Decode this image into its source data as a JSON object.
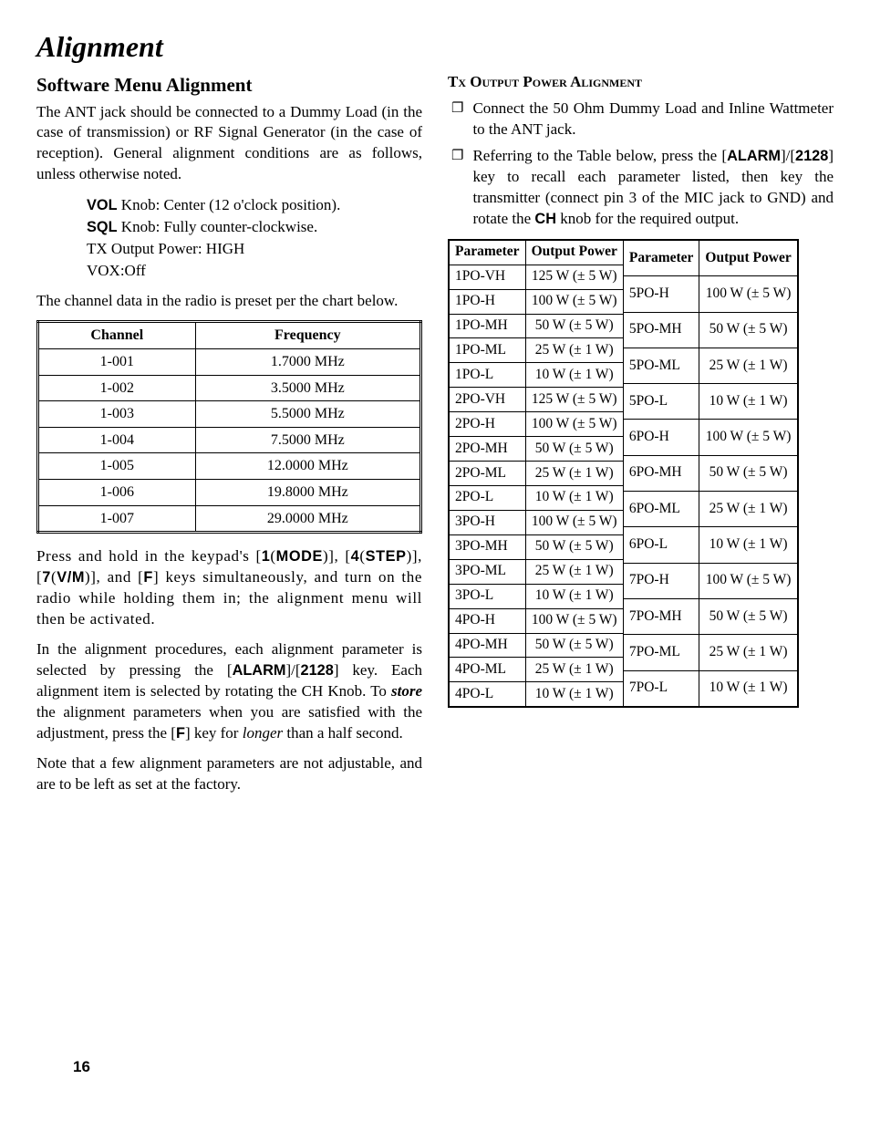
{
  "title": "Alignment",
  "page_number": "16",
  "left": {
    "subhead": "Software Menu Alignment",
    "p1_a": "The ANT jack should be connected to a Dummy Load (in the case of transmission) or RF Signal Generator (in the case of reception). General alignment conditions are as follows, unless otherwise noted.",
    "knob": {
      "l1a": "VOL",
      "l1b": " Knob: Center (12 o'clock position).",
      "l2a": "SQL",
      "l2b": " Knob: Fully counter-clockwise.",
      "l3": "TX Output Power: HIGH",
      "l4": "VOX:Off"
    },
    "p2": "The channel data in the radio is preset per the chart below.",
    "table_headers": {
      "c": "Channel",
      "f": "Frequency"
    },
    "channels": [
      {
        "c": "1-001",
        "f": "1.7000 MHz"
      },
      {
        "c": "1-002",
        "f": "3.5000 MHz"
      },
      {
        "c": "1-003",
        "f": "5.5000 MHz"
      },
      {
        "c": "1-004",
        "f": "7.5000 MHz"
      },
      {
        "c": "1-005",
        "f": "12.0000 MHz"
      },
      {
        "c": "1-006",
        "f": "19.8000 MHz"
      },
      {
        "c": "1-007",
        "f": "29.0000 MHz"
      }
    ],
    "p3_parts": {
      "a": "Press and hold in the keypad's [",
      "b": "1",
      "c": "(",
      "d": "MODE",
      "e": ")], [",
      "f": "4",
      "g": "(",
      "h": "STEP",
      "i": ")], [",
      "j": "7",
      "k": "(",
      "l": "V/M",
      "m": ")], and [",
      "n": "F",
      "o": "] keys simultaneously, and turn on the radio while holding them in; the alignment menu will then be activated."
    },
    "p4_parts": {
      "a": "In the alignment procedures, each alignment parameter is selected by pressing the [",
      "b": "ALARM",
      "c": "]/[",
      "d": "2128",
      "e": "] key. Each alignment item is selected by rotating the CH Knob. To ",
      "f": "store",
      "g": " the alignment parameters when you are satisfied with the adjustment, press the [",
      "h": "F",
      "i": "] key for ",
      "j": "longer",
      "k": " than a half second."
    },
    "p5": "Note that a few alignment parameters are not adjustable, and are to be left as set at the factory."
  },
  "right": {
    "secthead": "Tx Output Power Alignment",
    "item1": "Connect the 50 Ohm Dummy Load and Inline Wattmeter to the ANT jack.",
    "item2_parts": {
      "a": "Referring to the Table below, press the [",
      "b": "ALARM",
      "c": "]/[",
      "d": "2128",
      "e": "] key to recall each parameter listed, then key the transmitter (connect pin 3 of the MIC jack to GND) and rotate the ",
      "f": "CH",
      "g": " knob for the required output."
    },
    "power_headers": {
      "p": "Parameter",
      "o": "Output Power"
    },
    "power_left": [
      {
        "p": "1PO-VH",
        "o": "125 W (± 5 W)"
      },
      {
        "p": "1PO-H",
        "o": "100 W (± 5 W)"
      },
      {
        "p": "1PO-MH",
        "o": "50 W (± 5 W)"
      },
      {
        "p": "1PO-ML",
        "o": "25 W (± 1 W)"
      },
      {
        "p": "1PO-L",
        "o": "10 W (± 1 W)"
      },
      {
        "p": "2PO-VH",
        "o": "125 W (± 5 W)"
      },
      {
        "p": "2PO-H",
        "o": "100 W (± 5 W)"
      },
      {
        "p": "2PO-MH",
        "o": "50 W (± 5 W)"
      },
      {
        "p": "2PO-ML",
        "o": "25 W (± 1 W)"
      },
      {
        "p": "2PO-L",
        "o": "10 W (± 1 W)"
      },
      {
        "p": "3PO-H",
        "o": "100 W (± 5 W)"
      },
      {
        "p": "3PO-MH",
        "o": "50 W (± 5 W)"
      },
      {
        "p": "3PO-ML",
        "o": "25 W (± 1 W)"
      },
      {
        "p": "3PO-L",
        "o": "10 W (± 1 W)"
      },
      {
        "p": "4PO-H",
        "o": "100 W (± 5 W)"
      },
      {
        "p": "4PO-MH",
        "o": "50 W (± 5 W)"
      },
      {
        "p": "4PO-ML",
        "o": "25 W (± 1 W)"
      },
      {
        "p": "4PO-L",
        "o": "10 W (± 1 W)"
      }
    ],
    "power_right": [
      {
        "p": "5PO-H",
        "o": "100 W (± 5 W)"
      },
      {
        "p": "5PO-MH",
        "o": "50 W (± 5 W)"
      },
      {
        "p": "5PO-ML",
        "o": "25 W (± 1 W)"
      },
      {
        "p": "5PO-L",
        "o": "10 W (± 1 W)"
      },
      {
        "p": "6PO-H",
        "o": "100 W (± 5 W)"
      },
      {
        "p": "6PO-MH",
        "o": "50 W (± 5 W)"
      },
      {
        "p": "6PO-ML",
        "o": "25 W (± 1 W)"
      },
      {
        "p": "6PO-L",
        "o": "10 W (± 1 W)"
      },
      {
        "p": "7PO-H",
        "o": "100 W (± 5 W)"
      },
      {
        "p": "7PO-MH",
        "o": "50 W (± 5 W)"
      },
      {
        "p": "7PO-ML",
        "o": "25 W (± 1 W)"
      },
      {
        "p": "7PO-L",
        "o": "10 W (± 1 W)"
      }
    ]
  }
}
